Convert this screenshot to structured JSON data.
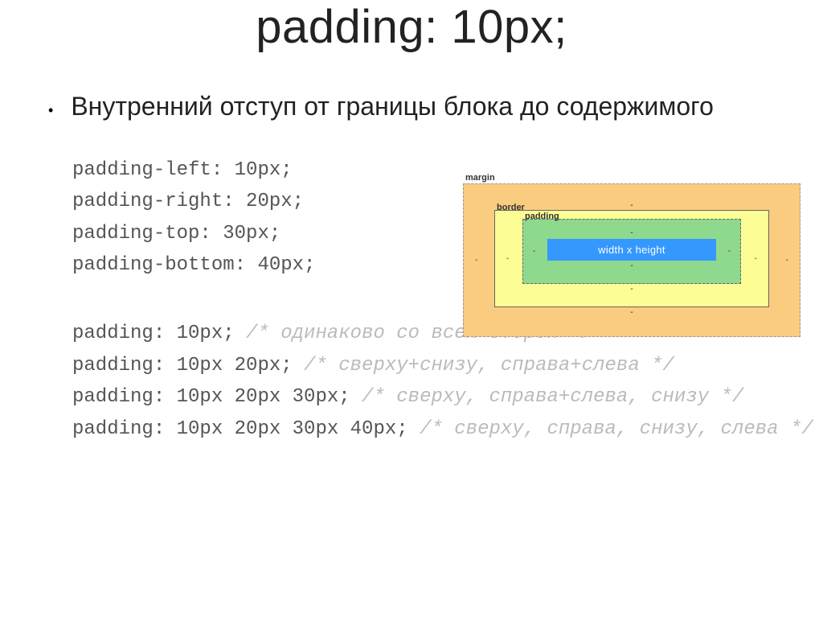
{
  "title": "padding: 10px;",
  "bullet": "Внутренний отступ от границы блока до содержимого",
  "codeBlock1": {
    "l1": "padding-left: 10px;",
    "l2": "padding-right: 20px;",
    "l3": "padding-top: 30px;",
    "l4": "padding-bottom: 40px;"
  },
  "codeBlock2": {
    "c1": "padding: 10px; ",
    "c1_comment": "/* одинаково со всех сторон */",
    "c2": "padding: 10px 20px; ",
    "c2_comment": "/* сверху+снизу, справа+слева */",
    "c3": "padding: 10px 20px 30px; ",
    "c3_comment": "/* сверху, справа+слева, снизу */",
    "c4": "padding: 10px 20px 30px 40px; ",
    "c4_comment": "/* сверху, справа, снизу, слева */"
  },
  "boxModel": {
    "margin_label": "margin",
    "border_label": "border",
    "padding_label": "padding",
    "content": "width x height",
    "dash": "-"
  }
}
